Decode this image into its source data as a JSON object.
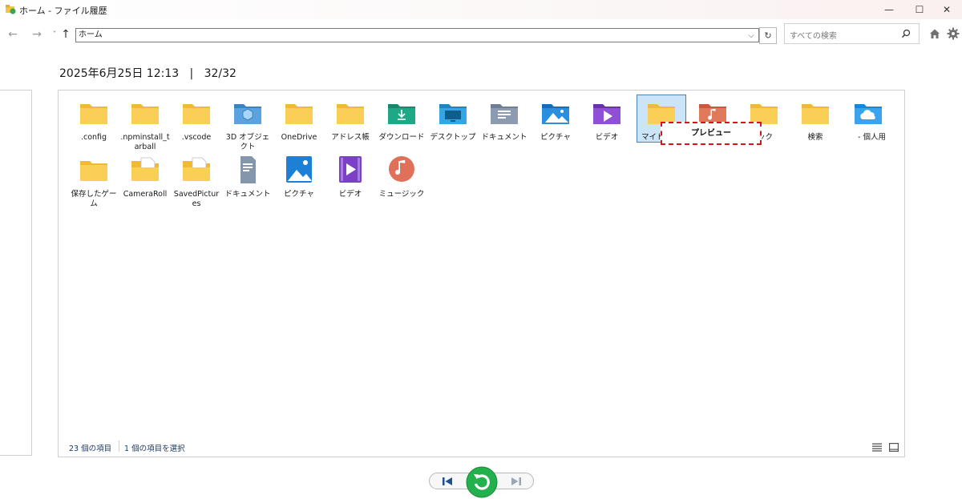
{
  "window": {
    "title": "ホーム - ファイル履歴",
    "minimize_glyph": "—",
    "maximize_glyph": "☐",
    "close_glyph": "✕"
  },
  "nav": {
    "back_glyph": "←",
    "forward_glyph": "→",
    "recent_glyph": "˅",
    "up_glyph": "↑",
    "address": "ホーム",
    "address_dropdown_glyph": "⌵",
    "refresh_glyph": "↻",
    "search_placeholder": "すべての検索"
  },
  "header": {
    "datetime": "2025年6月25日 12:13",
    "separator": "|",
    "position": "32/32"
  },
  "items": [
    {
      "label": ".config",
      "icon": "folder-icon"
    },
    {
      "label": ".npminstall_tarball",
      "icon": "folder-icon"
    },
    {
      "label": ".vscode",
      "icon": "folder-icon"
    },
    {
      "label": "3D オブジェクト",
      "icon": "3d-objects-folder-icon"
    },
    {
      "label": "OneDrive",
      "icon": "folder-icon"
    },
    {
      "label": "アドレス帳",
      "icon": "folder-icon"
    },
    {
      "label": "ダウンロード",
      "icon": "downloads-folder-icon"
    },
    {
      "label": "デスクトップ",
      "icon": "desktop-folder-icon"
    },
    {
      "label": "ドキュメント",
      "icon": "documents-folder-icon"
    },
    {
      "label": "ピクチャ",
      "icon": "pictures-folder-icon"
    },
    {
      "label": "ビデオ",
      "icon": "videos-folder-icon"
    },
    {
      "label": "マイド",
      "icon": "folder-icon"
    },
    {
      "label": "",
      "icon": "music-folder-icon"
    },
    {
      "label": "ック",
      "icon": "folder-icon"
    },
    {
      "label": "検索",
      "icon": "folder-icon"
    },
    {
      "label": "- 個人用",
      "icon": "onedrive-folder-icon"
    },
    {
      "label": "保存したゲーム",
      "icon": "folder-icon"
    },
    {
      "label": "CameraRoll",
      "icon": "file-folder-icon"
    },
    {
      "label": "SavedPictures",
      "icon": "file-folder-icon"
    },
    {
      "label": "ドキュメント",
      "icon": "documents-library-icon"
    },
    {
      "label": "ピクチャ",
      "icon": "pictures-library-icon"
    },
    {
      "label": "ビデオ",
      "icon": "videos-library-icon"
    },
    {
      "label": "ミュージック",
      "icon": "music-library-icon"
    }
  ],
  "preview_tooltip": "プレビュー",
  "status": {
    "item_count": "23 個の項目",
    "selected": "1 個の項目を選択"
  },
  "colors": {
    "folder": "#f9cf56",
    "selection": "#cce4f7",
    "tooltip_border": "#d8141e",
    "restore_green": "#22b14c"
  }
}
